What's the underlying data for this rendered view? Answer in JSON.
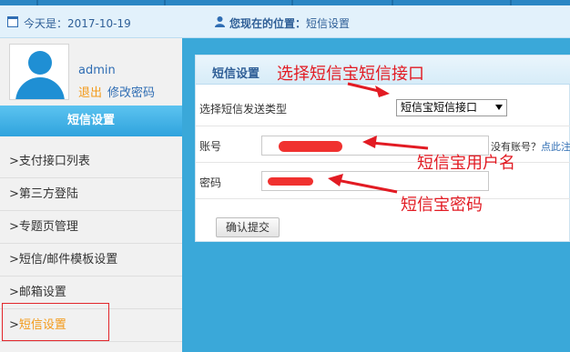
{
  "header": {
    "date_label": "今天是：2017-10-19",
    "location_prefix": "您现在的位置：",
    "location_current": "短信设置"
  },
  "user": {
    "name": "admin",
    "logout_label": "退出",
    "change_password_label": "修改密码"
  },
  "sidebar": {
    "section_title": "短信设置",
    "items": [
      {
        "label": ">支付接口列表"
      },
      {
        "label": ">第三方登陆"
      },
      {
        "label": ">专题页管理"
      },
      {
        "label": ">短信/邮件模板设置"
      },
      {
        "label": ">邮箱设置"
      },
      {
        "label": "短信设置",
        "prefix": ">",
        "active": true
      }
    ]
  },
  "panel": {
    "title": "短信设置",
    "send_type_label": "选择短信发送类型",
    "send_type_value": "短信宝短信接口",
    "account_label": "账号",
    "password_label": "密码",
    "register_hint": "没有账号？",
    "register_link": "点此注",
    "submit_label": "确认提交"
  },
  "annotations": {
    "interface": "选择短信宝短信接口",
    "username": "短信宝用户名",
    "password": "短信宝密码"
  },
  "colors": {
    "accent_blue": "#3aa8d9",
    "active_orange": "#f39a1a",
    "annotation_red": "#e21b23"
  }
}
